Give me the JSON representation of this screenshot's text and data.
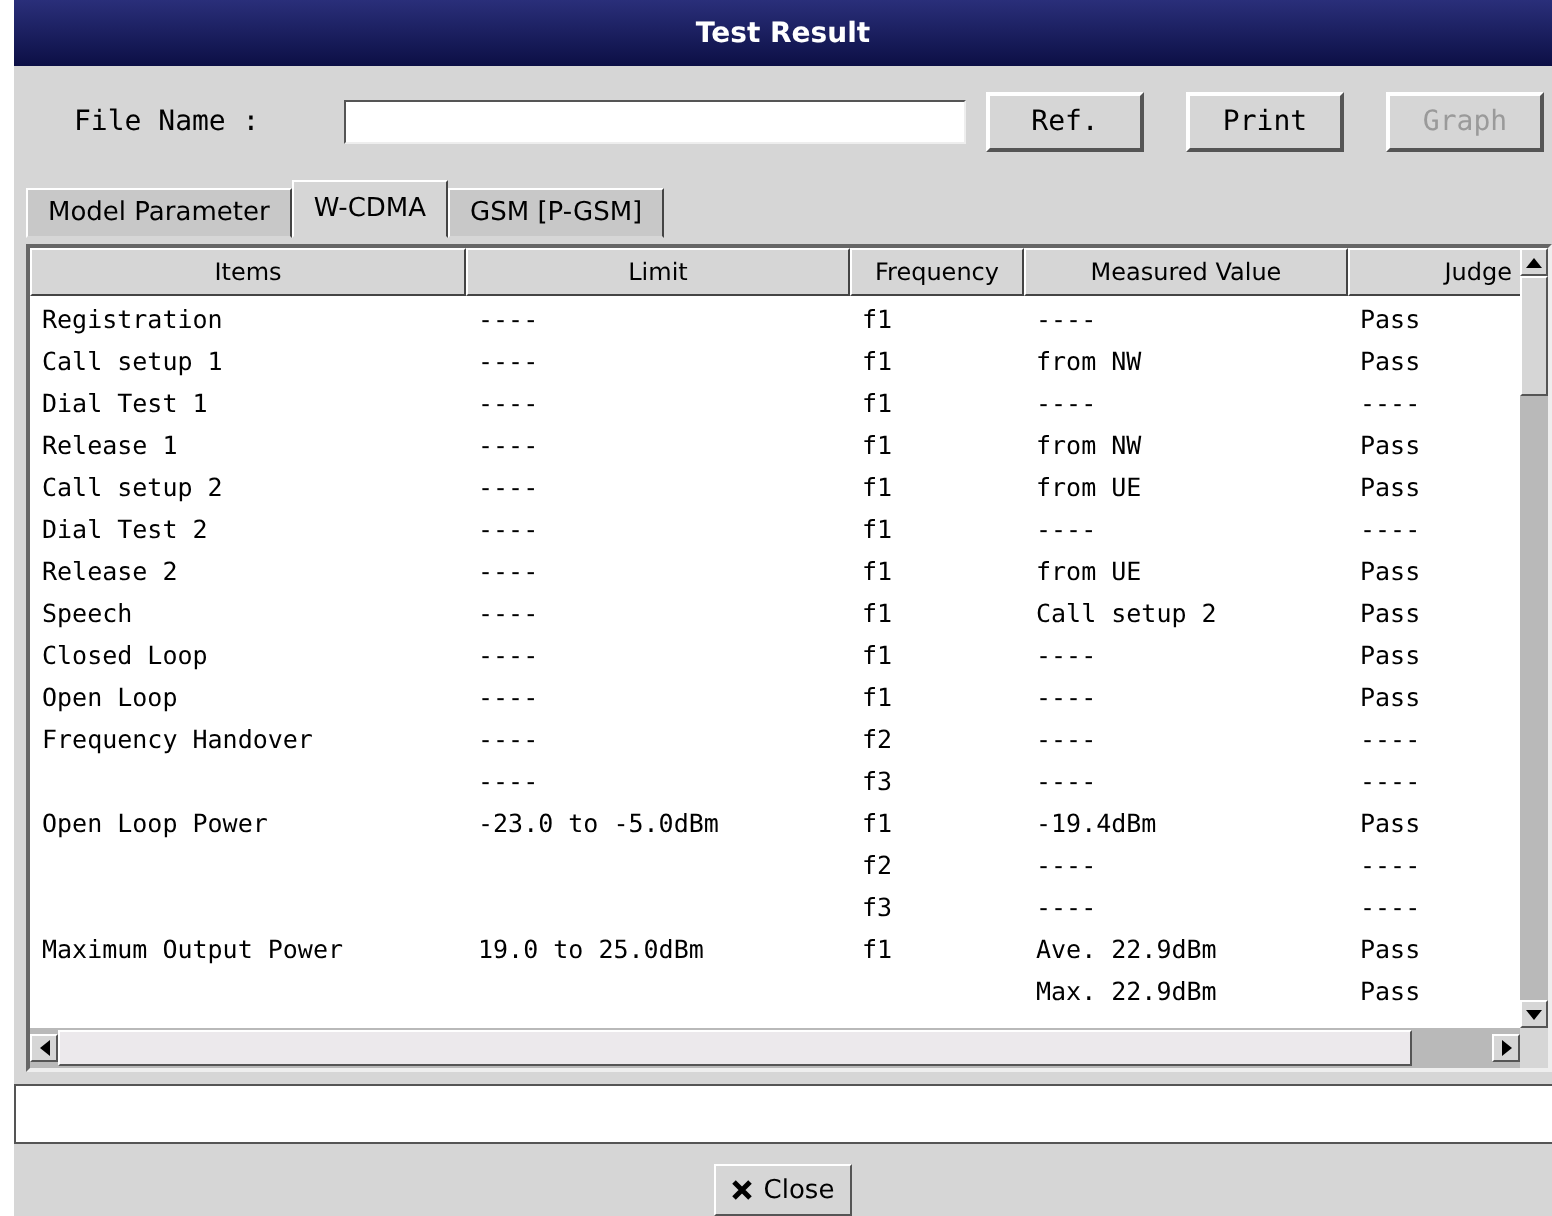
{
  "window": {
    "title": "Test Result"
  },
  "file_name": {
    "label": "File Name :"
  },
  "buttons": [
    {
      "label": "Ref.",
      "disabled": false
    },
    {
      "label": "Print",
      "disabled": false
    },
    {
      "label": "Graph",
      "disabled": true
    }
  ],
  "tabs": [
    {
      "label": "Model Parameter",
      "selected": false
    },
    {
      "label": "W-CDMA",
      "selected": true
    },
    {
      "label": "GSM [P-GSM]",
      "selected": false
    }
  ],
  "table": {
    "columns": [
      "Items",
      "Limit",
      "Frequency",
      "Measured Value",
      "Judge"
    ],
    "rows": [
      [
        "Registration",
        "----",
        "f1",
        "----",
        "Pass"
      ],
      [
        "Call setup 1",
        "----",
        "f1",
        "from NW",
        "Pass"
      ],
      [
        "Dial Test 1",
        "----",
        "f1",
        "----",
        "----"
      ],
      [
        "Release 1",
        "----",
        "f1",
        "from NW",
        "Pass"
      ],
      [
        "Call setup 2",
        "----",
        "f1",
        "from UE",
        "Pass"
      ],
      [
        "Dial Test 2",
        "----",
        "f1",
        "----",
        "----"
      ],
      [
        "Release 2",
        "----",
        "f1",
        "from UE",
        "Pass"
      ],
      [
        "Speech",
        "----",
        "f1",
        "Call setup 2",
        "Pass"
      ],
      [
        "Closed Loop",
        "----",
        "f1",
        "----",
        "Pass"
      ],
      [
        "Open Loop",
        "----",
        "f1",
        "----",
        "Pass"
      ],
      [
        "Frequency Handover",
        "----",
        "f2",
        "----",
        "----"
      ],
      [
        "",
        "----",
        "f3",
        "----",
        "----"
      ],
      [
        "Open Loop Power",
        "-23.0 to -5.0dBm",
        "f1",
        "-19.4dBm",
        "Pass"
      ],
      [
        "",
        "",
        "f2",
        "----",
        "----"
      ],
      [
        "",
        "",
        "f3",
        "----",
        "----"
      ],
      [
        "Maximum Output Power",
        "19.0 to 25.0dBm",
        "f1",
        "Ave. 22.9dBm",
        "Pass"
      ],
      [
        "",
        "",
        "",
        "Max. 22.9dBm",
        "Pass"
      ]
    ]
  },
  "close_button": {
    "label": "Close"
  }
}
